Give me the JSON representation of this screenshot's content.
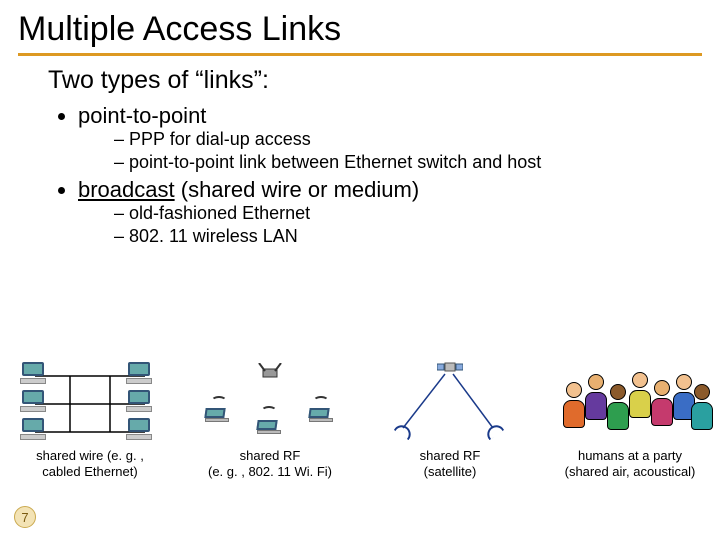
{
  "title": "Multiple Access Links",
  "subtitle": "Two types of “links”:",
  "bullets": [
    {
      "label": "point-to-point",
      "underline": false,
      "sub": [
        "PPP for dial-up access",
        "point-to-point link between Ethernet switch and host"
      ]
    },
    {
      "label": "broadcast (shared wire or medium)",
      "underline": true,
      "underline_word": "broadcast",
      "rest": " (shared wire or medium)",
      "sub": [
        "old-fashioned Ethernet",
        "802. 11 wireless LAN"
      ]
    }
  ],
  "examples": [
    {
      "caption_l1": "shared wire (e. g. ,",
      "caption_l2": "cabled Ethernet)"
    },
    {
      "caption_l1": "shared RF",
      "caption_l2": "(e. g. , 802. 11 Wi. Fi)"
    },
    {
      "caption_l1": "shared RF",
      "caption_l2": "(satellite)"
    },
    {
      "caption_l1": "humans at a party",
      "caption_l2": "(shared air, acoustical)"
    }
  ],
  "page_number": "7"
}
